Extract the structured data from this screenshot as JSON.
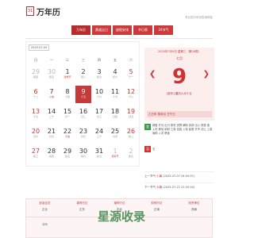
{
  "app": {
    "logo_glyph": "31",
    "title": "万年历",
    "slogan": "专业的万年历查询网站"
  },
  "nav": [
    {
      "label": "万年历"
    },
    {
      "label": "黄道吉日"
    },
    {
      "label": "放假安排"
    },
    {
      "label": "节日表"
    },
    {
      "label": "24节气"
    }
  ],
  "calendar": {
    "selected": "2025-07-09",
    "weekdays": [
      "日",
      "一",
      "二",
      "三",
      "四",
      "五",
      "六"
    ],
    "weeks": [
      [
        {
          "d": "29",
          "l": "初四",
          "o": true
        },
        {
          "d": "30",
          "l": "初五",
          "o": true
        },
        {
          "d": "1",
          "l": "建党节"
        },
        {
          "d": "2",
          "l": "初八"
        },
        {
          "d": "3",
          "l": "初九"
        },
        {
          "d": "4",
          "l": "初十"
        },
        {
          "d": "5",
          "l": "十一"
        }
      ],
      [
        {
          "d": "6",
          "l": "十二"
        },
        {
          "d": "7",
          "l": "小暑"
        },
        {
          "d": "8",
          "l": "十四"
        },
        {
          "d": "9",
          "l": "十五",
          "t": true
        },
        {
          "d": "10",
          "l": "十六"
        },
        {
          "d": "11",
          "l": "十七"
        },
        {
          "d": "12",
          "l": "十八"
        }
      ],
      [
        {
          "d": "13",
          "l": "十九"
        },
        {
          "d": "14",
          "l": "二十"
        },
        {
          "d": "15",
          "l": "廿一"
        },
        {
          "d": "16",
          "l": "廿二"
        },
        {
          "d": "17",
          "l": "廿三"
        },
        {
          "d": "18",
          "l": "廿四"
        },
        {
          "d": "19",
          "l": "廿五"
        }
      ],
      [
        {
          "d": "20",
          "l": "廿六"
        },
        {
          "d": "21",
          "l": "廿七"
        },
        {
          "d": "22",
          "l": "大暑"
        },
        {
          "d": "23",
          "l": "廿九"
        },
        {
          "d": "24",
          "l": "三十"
        },
        {
          "d": "25",
          "l": "六月"
        },
        {
          "d": "26",
          "l": "初二"
        }
      ],
      [
        {
          "d": "27",
          "l": "初三"
        },
        {
          "d": "28",
          "l": "初四"
        },
        {
          "d": "29",
          "l": "初五"
        },
        {
          "d": "30",
          "l": "初六"
        },
        {
          "d": "31",
          "l": "初七"
        },
        {
          "d": "1",
          "l": "建军节",
          "o": true
        },
        {
          "d": "2",
          "l": "初九",
          "o": true
        }
      ]
    ]
  },
  "detail": {
    "date_line": "2025年7月9日 星期三（第28周）",
    "month": "七月",
    "day": "9",
    "lunar": "[蛇年] 農历六月十五",
    "ganzhi": "乙巳年 癸未月 壬午日",
    "yi_label": "宜",
    "yi": "嫁娶 开光 出行 祭祀 安葬 解除 拆卸 出火 修造 造 入宅 移徙 纳财 立券 挂匾 入殓 起基 开市 动土 上梁 栽种 入宅 移徙",
    "ji_label": "忌",
    "ji": "无",
    "prev_term_label": "上一节气",
    "prev_term_name": "小暑",
    "prev_term_time": "(2025-07-07 04:04:57)",
    "next_term_label": "下一节气",
    "next_term_name": "大暑",
    "next_term_time": "(2025-07-22 21:29:24)"
  },
  "info": {
    "headers": [
      "彭祖百忌",
      "喜神方位",
      "福神方位",
      "财神方位",
      "阳贵神位"
    ],
    "values": [
      "正北",
      "正东",
      "东北",
      "正南",
      "西南"
    ],
    "row2": [
      "冲马",
      "",
      "",
      "",
      ""
    ]
  },
  "watermark": "星源收录"
}
